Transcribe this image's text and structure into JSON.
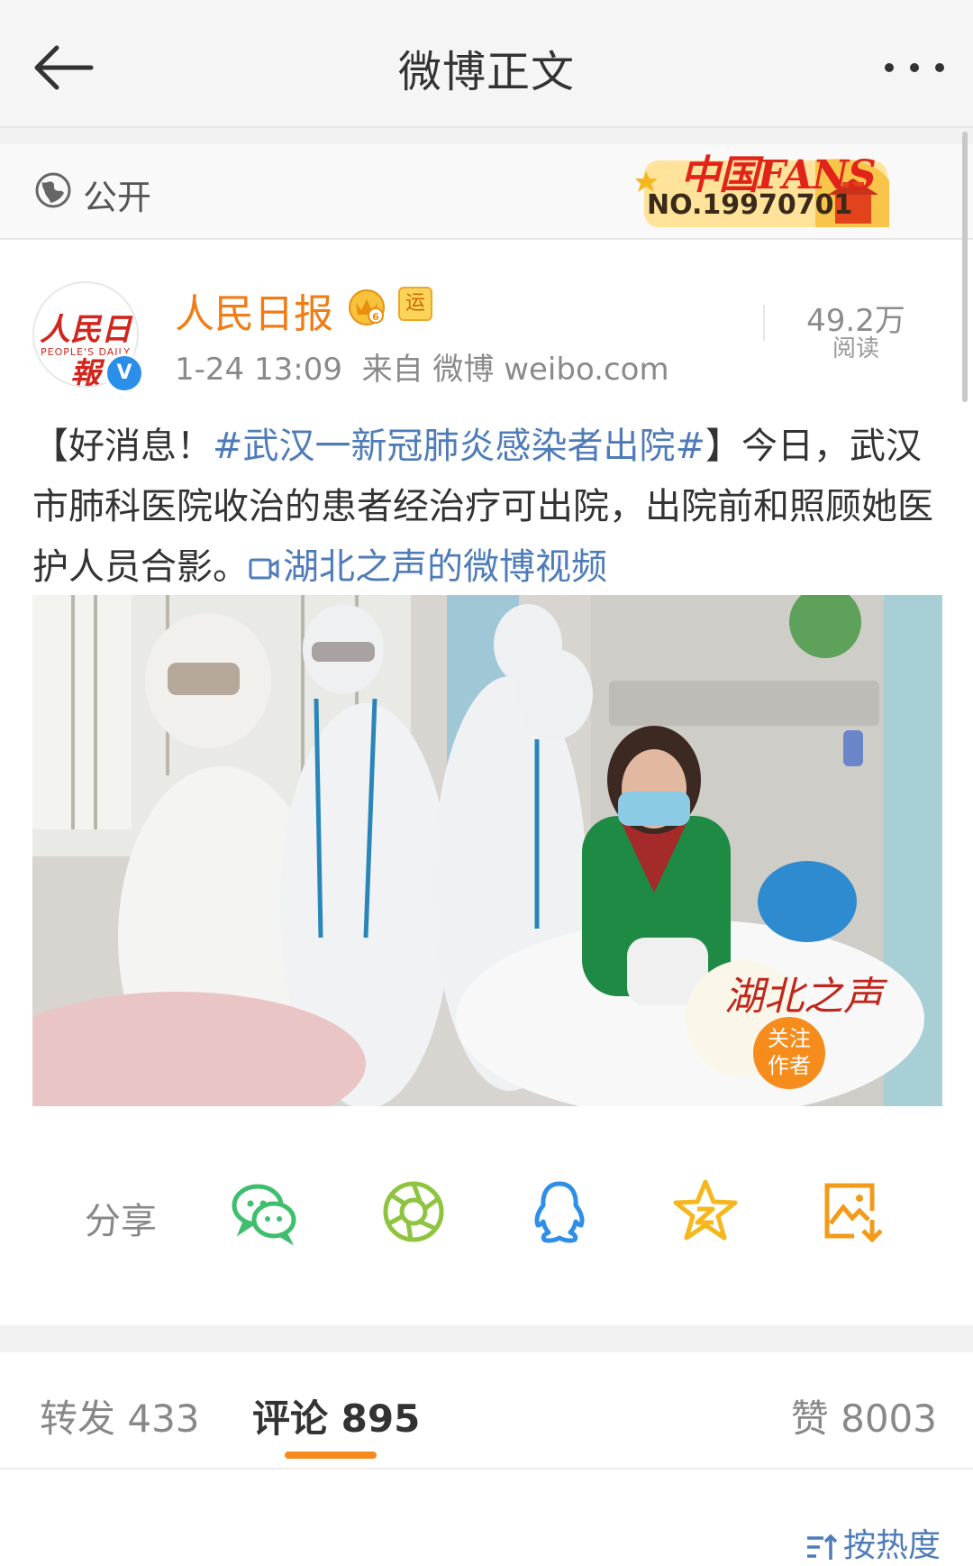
{
  "header": {
    "title": "微博正文"
  },
  "visibility": {
    "label": "公开"
  },
  "fans_badge": {
    "title": "中国FANS",
    "number": "NO.19970701"
  },
  "author": {
    "name": "人民日报",
    "avatar_text": "人民日報",
    "avatar_subtext": "PEOPLE'S DAILY",
    "verified_mark": "V",
    "yun_badge": "运",
    "time": "1-24 13:09",
    "source": "来自 微博 weibo.com"
  },
  "reads": {
    "count": "49.2万",
    "label": "阅读"
  },
  "post": {
    "prefix": "【好消息！",
    "hashtag": "#武汉一新冠肺炎感染者出院#",
    "body": "】今日，武汉市肺科医院收治的患者经治疗可出院，出院前和照顾她医护人员合影。",
    "video_link": "湖北之声的微博视频"
  },
  "video_overlay": {
    "watermark": "湖北之声",
    "follow_line1": "关注",
    "follow_line2": "作者"
  },
  "share": {
    "label": "分享",
    "targets": [
      "wechat-icon",
      "moments-icon",
      "qq-icon",
      "qzone-icon",
      "save-image-icon"
    ]
  },
  "tabs": {
    "repost": "转发 433",
    "comment": "评论 895",
    "like": "赞 8003"
  },
  "sort": {
    "label": "按热度"
  },
  "colors": {
    "accent": "#f78a1d",
    "link": "#4f7cb8",
    "author": "#f07c16"
  }
}
